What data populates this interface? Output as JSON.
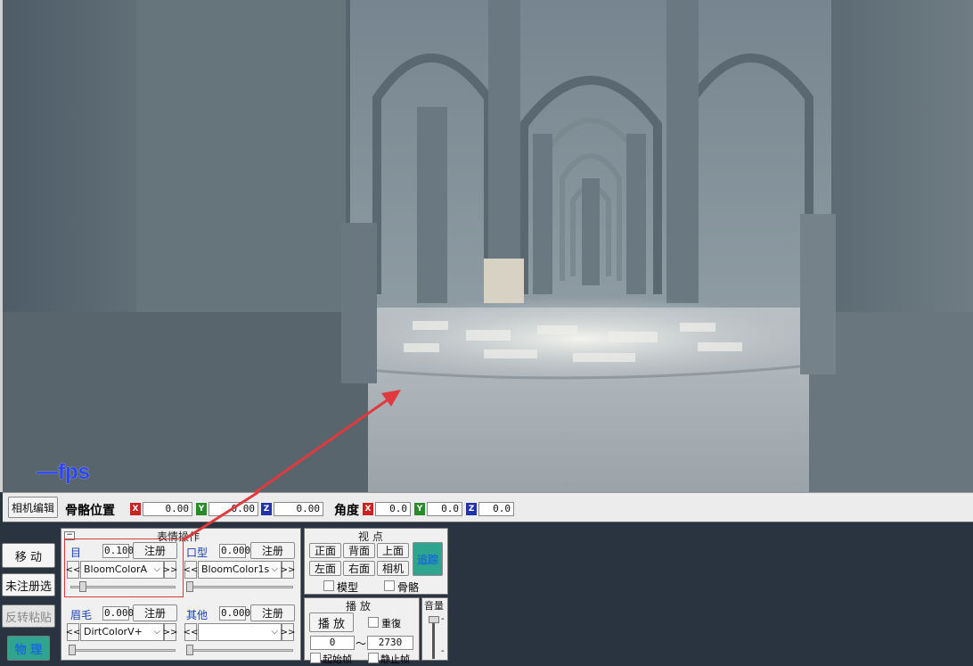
{
  "viewport": {
    "fps_label": "—fps"
  },
  "bonebar": {
    "camera_edit": "相机编辑",
    "bone_pos_label": "骨骼位置",
    "angle_label": "角度",
    "pos": {
      "x": "0.00",
      "y": "0.00",
      "z": "0.00"
    },
    "rot": {
      "x": "0.0",
      "y": "0.0",
      "z": "0.0"
    },
    "axis": {
      "x": "X",
      "y": "Y",
      "z": "Z"
    },
    "colors": {
      "x": "#cc2222",
      "y": "#2a8a2a",
      "z": "#2233aa"
    }
  },
  "left": {
    "move": "移 动",
    "unregistered": "未注册选",
    "reverse_paste": "反转粘贴",
    "physics": "物 理"
  },
  "expression": {
    "title": "表情操作",
    "collapse": "−",
    "eye": {
      "label": "目",
      "value": "0.100",
      "register": "注册",
      "combo": "BloomColorA"
    },
    "mouth": {
      "label": "口型",
      "value": "0.000",
      "register": "注册",
      "combo": "BloomColor1s"
    },
    "brow": {
      "label": "眉毛",
      "value": "0.000",
      "register": "注册",
      "combo": "DirtColorV+"
    },
    "other": {
      "label": "其他",
      "value": "0.000",
      "register": "注册",
      "combo": ""
    },
    "prev": "<<",
    "next": ">>"
  },
  "view": {
    "title": "视 点",
    "front": "正面",
    "back": "背面",
    "top": "上面",
    "left": "左面",
    "right": "右面",
    "camera": "相机",
    "follow": "追踪",
    "model": "模型",
    "bone": "骨骼"
  },
  "play": {
    "title": "播 放",
    "play_btn": "播 放",
    "repeat": "重復",
    "start_frame": "0",
    "tilde": "〜",
    "end_frame": "2730",
    "start_label": "起始帧",
    "stop_label": "静止帧"
  },
  "volume": {
    "title": "音量",
    "dash_top": "-",
    "dash_bottom": "-"
  },
  "accent": {
    "follow_text": "#1a6cd6",
    "follow_bg": "#2fa58f",
    "physics_text": "#1a6cd6",
    "physics_bg": "#2fa58f",
    "highlight": "#d83a3a"
  }
}
